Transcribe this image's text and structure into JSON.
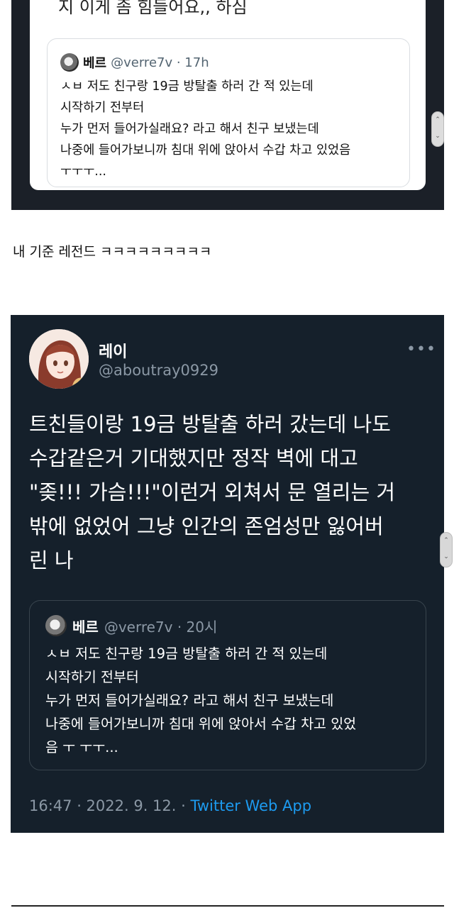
{
  "top_card": {
    "partial_text": "지 이게 좀 힘들어요,, 하심",
    "quote": {
      "name": "베르",
      "handle_time": "@verre7v · 17h",
      "lines": [
        "ㅅㅂ 저도 친구랑 19금 방탈출 하러 간 적 있는데",
        "시작하기 전부터",
        "누가 먼저 들어가실래요? 라고 해서 친구 보냈는데",
        "나중에 들어가보니까 침대 위에 앉아서 수갑 차고 있었음",
        "ㅜㅜㅜ..."
      ]
    }
  },
  "caption": "내 기준 레전드 ㅋㅋㅋㅋㅋㅋㅋㅋㅋ",
  "tweet": {
    "name": "레이",
    "handle": "@aboutray0929",
    "more": "•••",
    "body_lines": [
      "트친들이랑 19금 방탈출 하러 갔는데 나도",
      "수갑같은거 기대했지만 정작 벽에 대고",
      "\"좆!!! 가슴!!!\"이런거 외쳐서 문 열리는 거",
      "밖에 없었어 그냥 인간의 존엄성만 잃어버",
      "린 나"
    ],
    "quote": {
      "name": "베르",
      "handle_time": "@verre7v · 20시",
      "lines": [
        "ㅅㅂ 저도 친구랑 19금 방탈출 하러 간 적 있는데",
        "시작하기 전부터",
        "누가 먼저 들어가실래요? 라고 해서 친구 보냈는데",
        "나중에 들어가보니까 침대 위에 앉아서 수갑 차고 있었",
        "음 ㅜ ㅜㅜ..."
      ]
    },
    "timestamp": "16:47 · 2022. 9. 12. · ",
    "app": "Twitter Web App"
  },
  "colors": {
    "dark_bg": "#15202b",
    "link_blue": "#1d9bf0",
    "muted": "#8b98a5"
  }
}
